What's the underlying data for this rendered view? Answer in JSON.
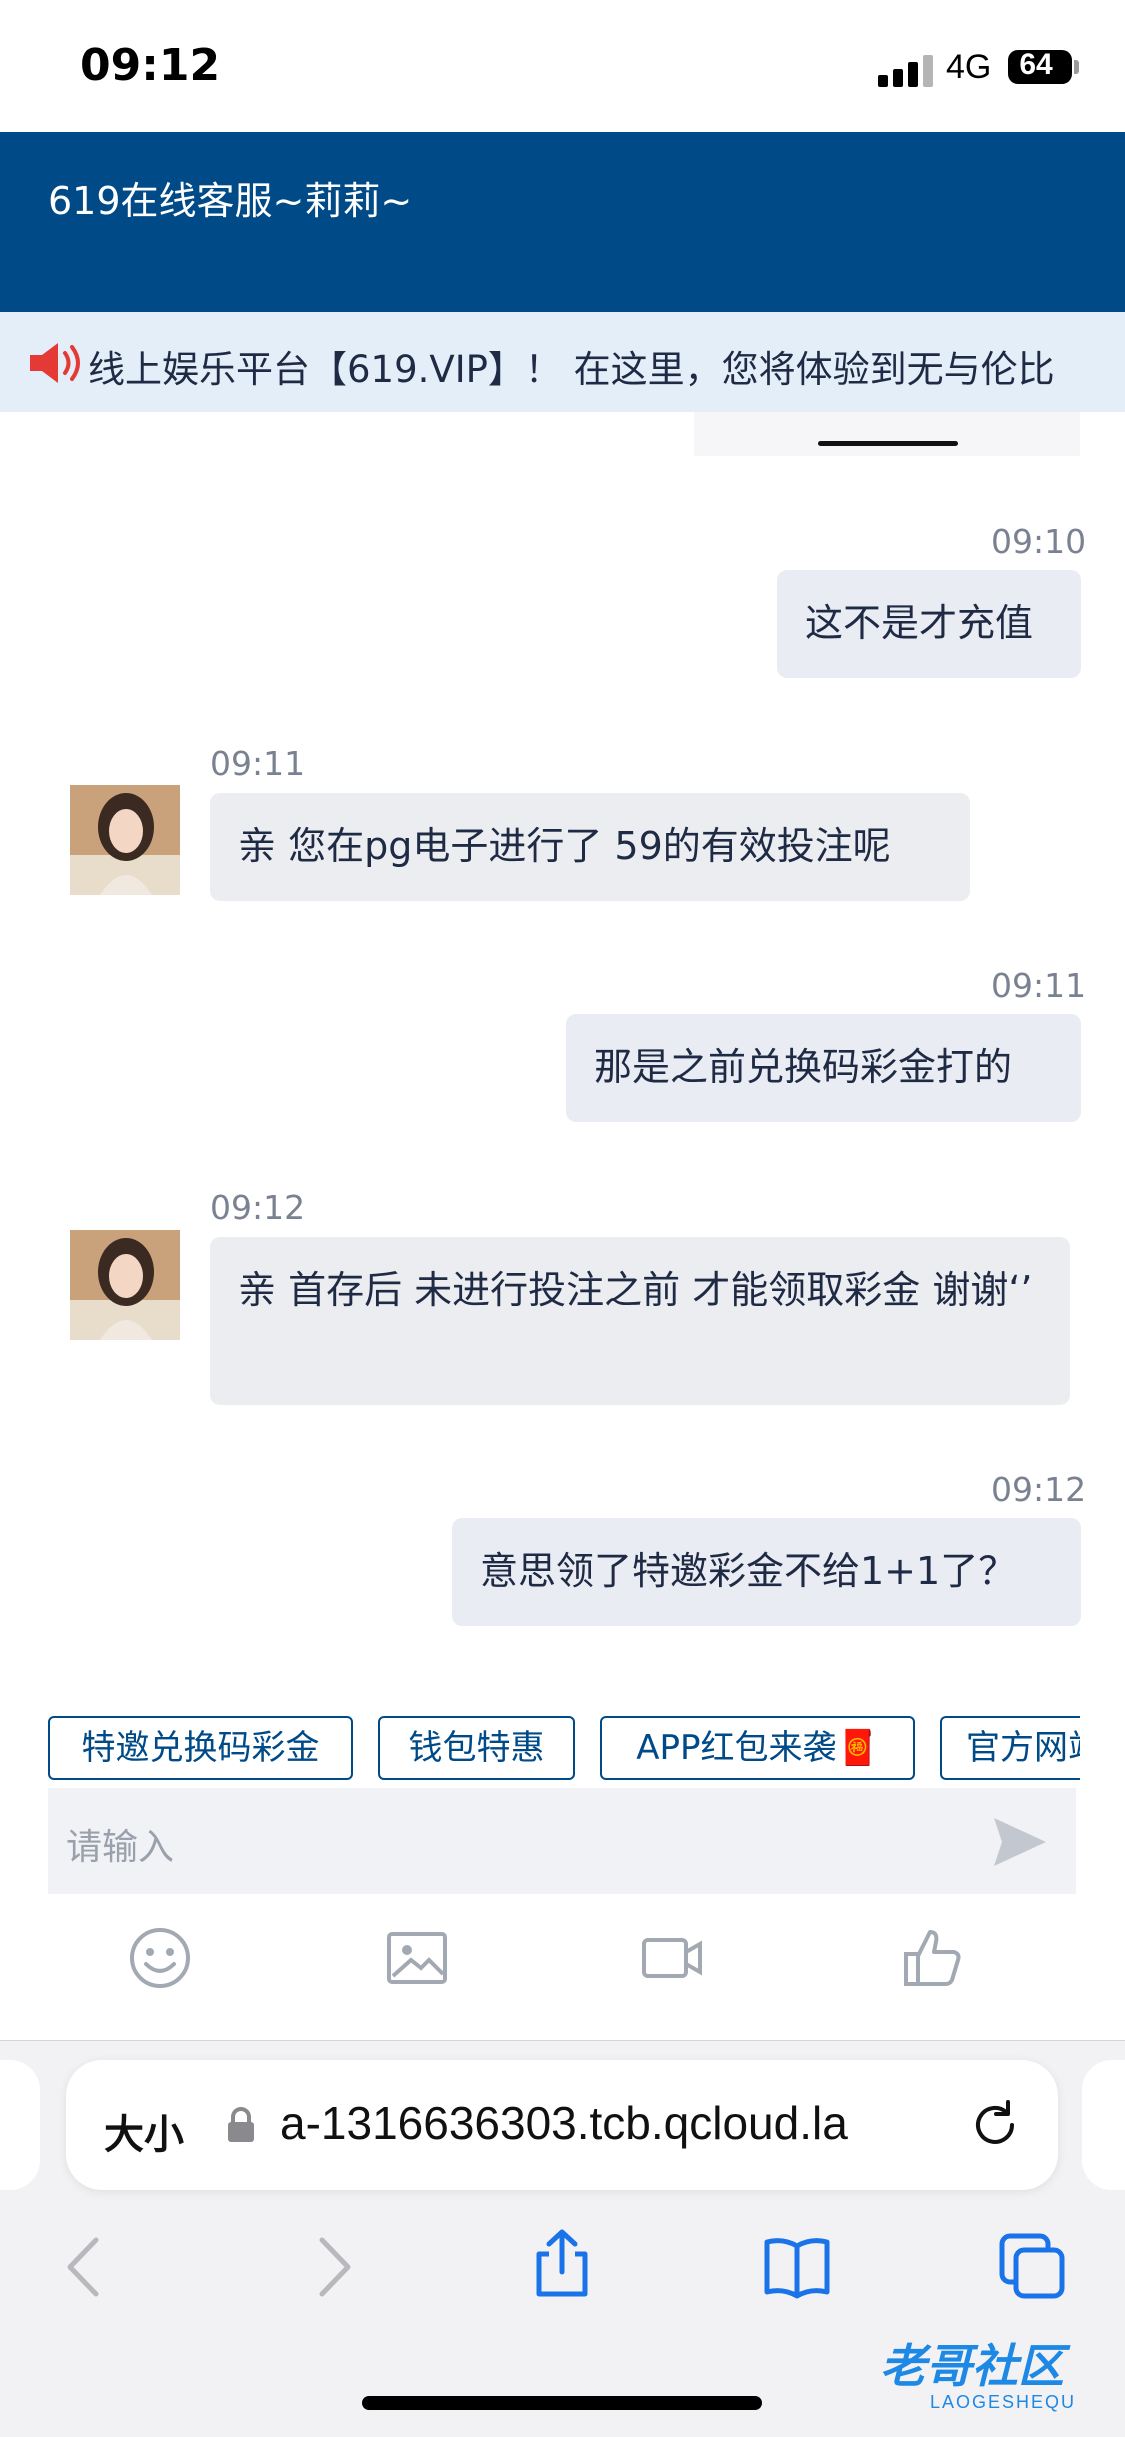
{
  "status_bar": {
    "time": "09:12",
    "network": "4G",
    "battery": "64"
  },
  "header": {
    "title": "619在线客服~莉莉~"
  },
  "marquee": {
    "text": "线上娱乐平台【619.VIP】！ 在这里，您将体验到无与伦比"
  },
  "messages": [
    {
      "side": "user",
      "time": "09:10",
      "text": "这不是才充值"
    },
    {
      "side": "agent",
      "time": "09:11",
      "text": "亲 您在pg电子进行了 59的有效投注呢"
    },
    {
      "side": "user",
      "time": "09:11",
      "text": "那是之前兑换码彩金打的"
    },
    {
      "side": "agent",
      "time": "09:12",
      "text": "亲 首存后 未进行投注之前 才能领取彩金 谢谢‘’"
    },
    {
      "side": "user",
      "time": "09:12",
      "text": "意思领了特邀彩金不给1+1了？"
    }
  ],
  "quick_replies": [
    "特邀兑换码彩金",
    "钱包特惠",
    "APP红包来袭🧧",
    "官方网站"
  ],
  "input": {
    "placeholder": "请输入"
  },
  "toolbar": {
    "icons": [
      "emoji-icon",
      "image-icon",
      "video-icon",
      "thumbs-up-icon"
    ]
  },
  "browser": {
    "text_size_label": "大小",
    "url": "a-1316636303.tcb.qcloud.la"
  },
  "watermark": {
    "text": "老哥社区",
    "sub": "LAOGESHEQU"
  },
  "colors": {
    "header": "#004a87",
    "marquee_bg": "#e3eef9",
    "bubble": "#e9edf3",
    "speaker": "#e53935"
  }
}
